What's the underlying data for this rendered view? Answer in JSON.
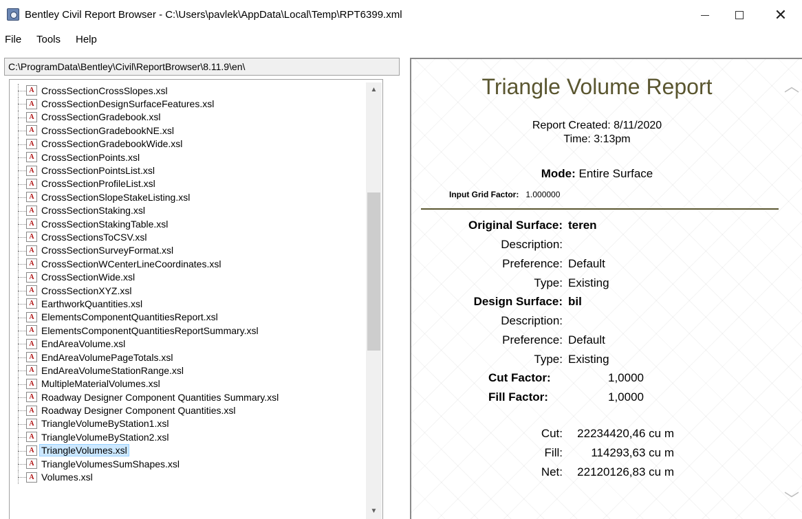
{
  "window": {
    "title": "Bentley Civil Report Browser - C:\\Users\\pavlek\\AppData\\Local\\Temp\\RPT6399.xml",
    "minimize_glyph": "—",
    "maximize_glyph": "☐",
    "close_glyph": "✕"
  },
  "menu": {
    "file": "File",
    "tools": "Tools",
    "help": "Help"
  },
  "path": "C:\\ProgramData\\Bentley\\Civil\\ReportBrowser\\8.11.9\\en\\",
  "file_icon_glyph": "A",
  "files": [
    {
      "label": "CrossSectionCrossSlopes.xsl"
    },
    {
      "label": "CrossSectionDesignSurfaceFeatures.xsl"
    },
    {
      "label": "CrossSectionGradebook.xsl"
    },
    {
      "label": "CrossSectionGradebookNE.xsl"
    },
    {
      "label": "CrossSectionGradebookWide.xsl"
    },
    {
      "label": "CrossSectionPoints.xsl"
    },
    {
      "label": "CrossSectionPointsList.xsl"
    },
    {
      "label": "CrossSectionProfileList.xsl"
    },
    {
      "label": "CrossSectionSlopeStakeListing.xsl"
    },
    {
      "label": "CrossSectionStaking.xsl"
    },
    {
      "label": "CrossSectionStakingTable.xsl"
    },
    {
      "label": "CrossSectionsToCSV.xsl"
    },
    {
      "label": "CrossSectionSurveyFormat.xsl"
    },
    {
      "label": "CrossSectionWCenterLineCoordinates.xsl"
    },
    {
      "label": "CrossSectionWide.xsl"
    },
    {
      "label": "CrossSectionXYZ.xsl"
    },
    {
      "label": "EarthworkQuantities.xsl"
    },
    {
      "label": "ElementsComponentQuantitiesReport.xsl"
    },
    {
      "label": "ElementsComponentQuantitiesReportSummary.xsl"
    },
    {
      "label": "EndAreaVolume.xsl"
    },
    {
      "label": "EndAreaVolumePageTotals.xsl"
    },
    {
      "label": "EndAreaVolumeStationRange.xsl"
    },
    {
      "label": "MultipleMaterialVolumes.xsl"
    },
    {
      "label": "Roadway Designer Component Quantities Summary.xsl"
    },
    {
      "label": "Roadway Designer Component Quantities.xsl"
    },
    {
      "label": "TriangleVolumeByStation1.xsl"
    },
    {
      "label": "TriangleVolumeByStation2.xsl"
    },
    {
      "label": "TriangleVolumes.xsl",
      "selected": true
    },
    {
      "label": "TriangleVolumesSumShapes.xsl"
    },
    {
      "label": "Volumes.xsl"
    }
  ],
  "scroll": {
    "up_glyph": "▲",
    "down_glyph": "▼",
    "report_up_glyph": "︿",
    "report_down_glyph": "﹀"
  },
  "report": {
    "title": "Triangle Volume Report",
    "created": "Report Created:  8/11/2020",
    "time": "Time:  3:13pm",
    "mode_label": "Mode:",
    "mode_value": "Entire Surface",
    "grid_factor_label": "Input Grid Factor:",
    "grid_factor_value": "1.000000",
    "original_surface_label": "Original Surface:",
    "original_surface_value": "teren",
    "orig_description_label": "Description:",
    "orig_description_value": "",
    "orig_preference_label": "Preference:",
    "orig_preference_value": "Default",
    "orig_type_label": "Type:",
    "orig_type_value": "Existing",
    "design_surface_label": "Design Surface:",
    "design_surface_value": "bil",
    "design_description_label": "Description:",
    "design_description_value": "",
    "design_preference_label": "Preference:",
    "design_preference_value": "Default",
    "design_type_label": "Type:",
    "design_type_value": "Existing",
    "cut_factor_label": "Cut Factor:",
    "cut_factor_value": "1,0000",
    "fill_factor_label": "Fill Factor:",
    "fill_factor_value": "1,0000",
    "cut_label": "Cut:",
    "cut_value": "22234420,46 cu m",
    "fill_label": "Fill:",
    "fill_value": "114293,63 cu m",
    "net_label": "Net:",
    "net_value": "22120126,83 cu m"
  }
}
